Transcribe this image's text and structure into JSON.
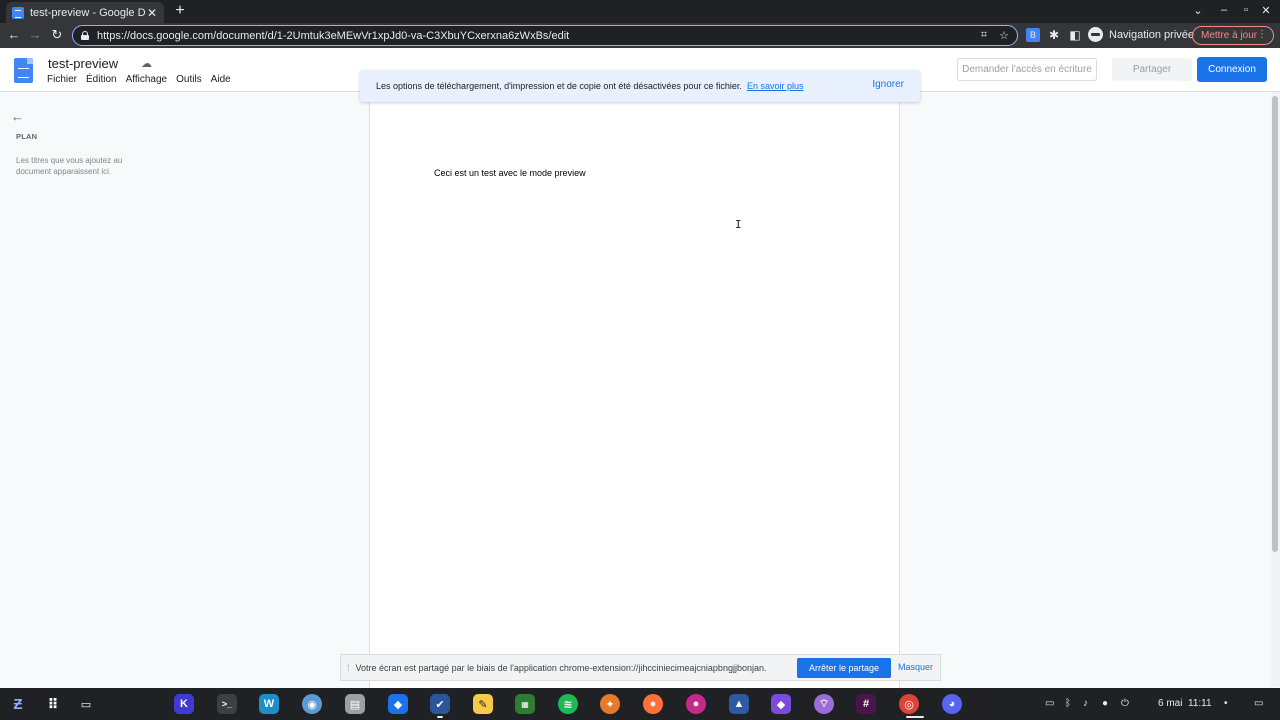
{
  "browser": {
    "tab_title": "test-preview - Google Docs",
    "tab_close": "✕",
    "new_tab": "+",
    "window_controls": [
      "⌄",
      "–",
      "▫",
      "✕"
    ],
    "url": "https://docs.google.com/document/d/1-2Umtuk3eMEwVr1xpJd0-va-C3XbuYCxerxna6zWxBs/edit",
    "incognito_label": "Navigation privée",
    "update_label": "Mettre à jour",
    "menu_dots": "⋮"
  },
  "docs": {
    "title": "test-preview",
    "menus": [
      "Fichier",
      "Édition",
      "Affichage",
      "Outils",
      "Aide"
    ],
    "request_access": "Demander l'accès en écriture",
    "share": "Partager",
    "login": "Connexion",
    "accent": "#1a73e8"
  },
  "banner": {
    "text": "Les options de téléchargement, d'impression et de copie ont été désactivées pour ce fichier.",
    "link": "En savoir plus",
    "dismiss": "Ignorer"
  },
  "outline": {
    "title": "PLAN",
    "hint": "Les titres que vous ajoutez au document apparaissent ici."
  },
  "document": {
    "body_text": "Ceci est un test avec le mode preview"
  },
  "sharing": {
    "text": "Votre écran est partagé par le biais de l'application chrome-extension://jihcciniecimeajcniapbngjjbonjan.",
    "stop": "Arrêter le partage",
    "hide": "Masquer"
  },
  "shelf": {
    "date": "6 mai",
    "time": "11:11"
  }
}
